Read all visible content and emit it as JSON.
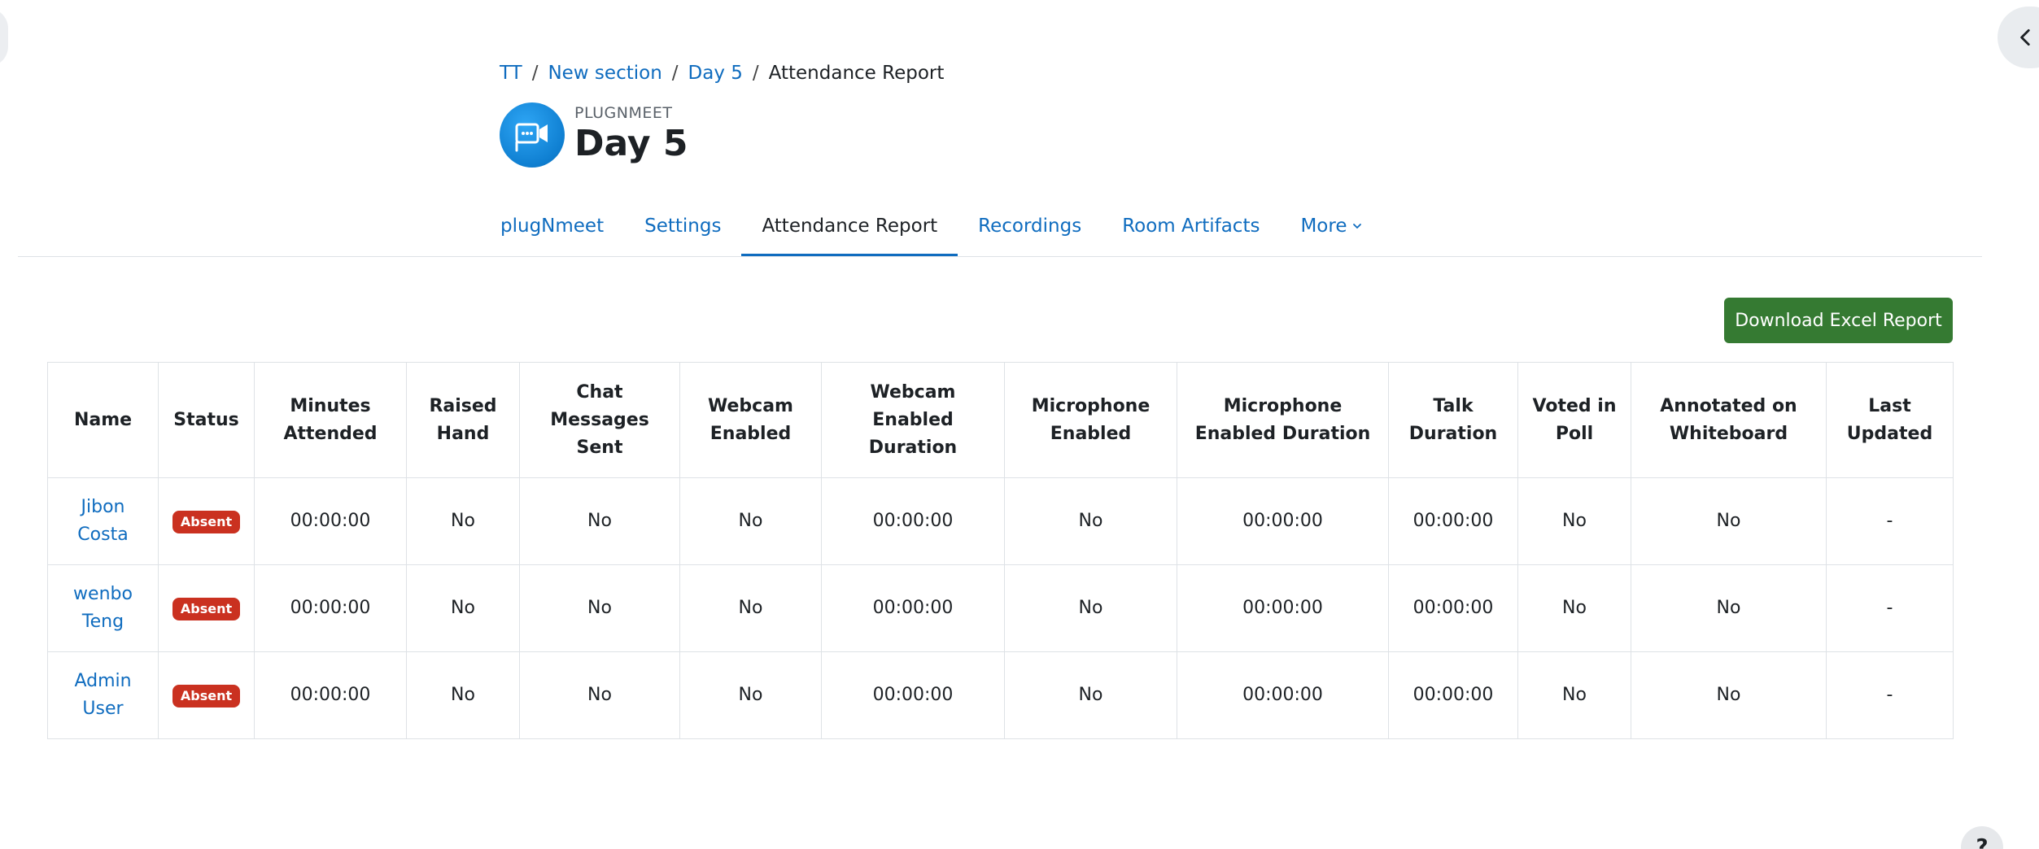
{
  "breadcrumb": [
    {
      "label": "TT",
      "link": true
    },
    {
      "label": "New section",
      "link": true
    },
    {
      "label": "Day 5",
      "link": true
    },
    {
      "label": "Attendance Report",
      "link": false
    }
  ],
  "header": {
    "plugin_label": "PLUGNMEET",
    "title": "Day 5"
  },
  "tabs": [
    {
      "label": "plugNmeet",
      "active": false
    },
    {
      "label": "Settings",
      "active": false
    },
    {
      "label": "Attendance Report",
      "active": true
    },
    {
      "label": "Recordings",
      "active": false
    },
    {
      "label": "Room Artifacts",
      "active": false
    },
    {
      "label": "More",
      "active": false
    }
  ],
  "actions": {
    "download_label": "Download Excel Report"
  },
  "help": {
    "label": "?"
  },
  "icons": {
    "drawer_toggle": "chevron-left-icon",
    "logo": "plugnmeet-logo-icon",
    "more": "chevron-down-icon"
  },
  "colors": {
    "link": "#0f6cbf",
    "primary_button": "#357a32",
    "badge_absent": "#ca3120"
  },
  "table": {
    "columns": [
      "Name",
      "Status",
      "Minutes Attended",
      "Raised Hand",
      "Chat Messages Sent",
      "Webcam Enabled",
      "Webcam Enabled Duration",
      "Microphone Enabled",
      "Microphone Enabled Duration",
      "Talk Duration",
      "Voted in Poll",
      "Annotated on Whiteboard",
      "Last Updated"
    ],
    "rows": [
      [
        "Jibon Costa",
        "Absent",
        "00:00:00",
        "No",
        "No",
        "No",
        "00:00:00",
        "No",
        "00:00:00",
        "00:00:00",
        "No",
        "No",
        "-"
      ],
      [
        "wenbo Teng",
        "Absent",
        "00:00:00",
        "No",
        "No",
        "No",
        "00:00:00",
        "No",
        "00:00:00",
        "00:00:00",
        "No",
        "No",
        "-"
      ],
      [
        "Admin User",
        "Absent",
        "00:00:00",
        "No",
        "No",
        "No",
        "00:00:00",
        "No",
        "00:00:00",
        "00:00:00",
        "No",
        "No",
        "-"
      ]
    ]
  }
}
